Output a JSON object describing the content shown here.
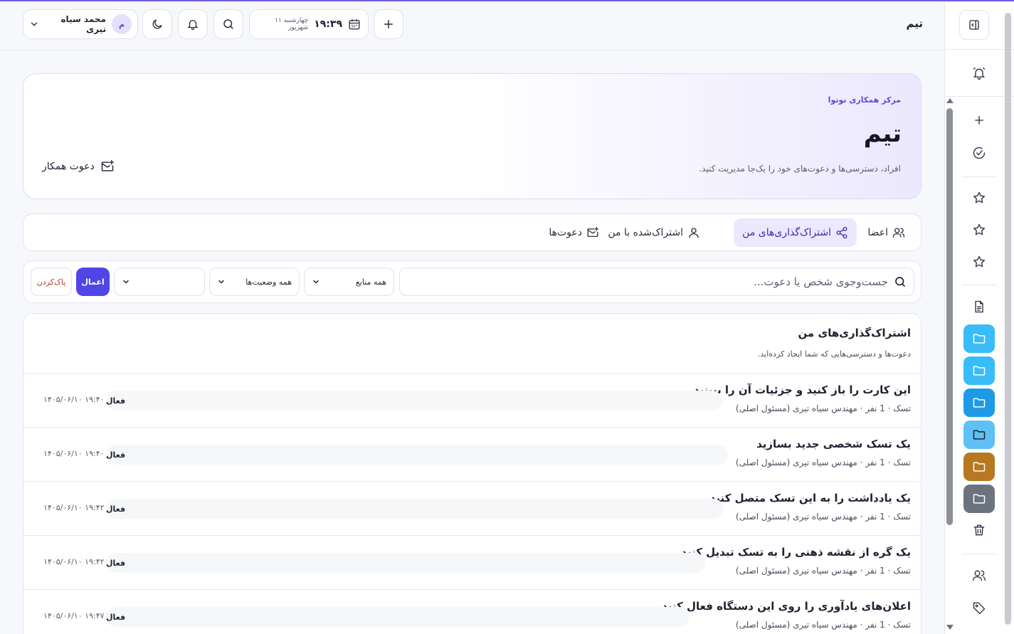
{
  "app": {
    "page_name": "تیم"
  },
  "header": {
    "time": "۱۹:۳۹",
    "date": "چهارشنبه ۱۱ شهریور",
    "user": {
      "initial": "م",
      "name": "محمد سیاه تیری"
    }
  },
  "hero": {
    "eyebrow": "مرکز همکاری نوتوا",
    "title": "تیم",
    "description": "افراد، دسترسی‌ها و دعوت‌های خود را یک‌جا مدیریت کنید.",
    "invite_label": "دعوت همکار"
  },
  "tabs": [
    {
      "label": "اعضا"
    },
    {
      "label": "اشتراک‌گذاری‌های من"
    },
    {
      "label": "اشتراک‌شده با من"
    },
    {
      "label": "دعوت‌ها"
    }
  ],
  "filters": {
    "search_placeholder": "جست‌وجوی شخص یا دعوت...",
    "source_select": "همه منابع",
    "status_select": "همه وضعیت‌ها",
    "third_select": "",
    "apply_label": "اعمال",
    "clear_label": "پاک‌کردن"
  },
  "list": {
    "title": "اشتراک‌گذاری‌های من",
    "subtitle": "دعوت‌ها و دسترسی‌هایی که شما ایجاد کرده‌اید.",
    "rows": [
      {
        "title": "این کارت را باز کنید و جزئیات آن را ببینید",
        "meta": "تسک · 1 نفر · مهندس سیاه تیری (مسئول اصلی)",
        "status": "فعال",
        "date": "۱۴۰۵/۰۶/۱۰ ۱۹:۴۰"
      },
      {
        "title": "یک تسک شخصی جدید بسازید",
        "meta": "تسک · 1 نفر · مهندس سیاه تیری (مسئول اصلی)",
        "status": "فعال",
        "date": "۱۴۰۵/۰۶/۱۰ ۱۹:۴۰"
      },
      {
        "title": "یک یادداشت را به این تسک متصل کنید",
        "meta": "تسک · 1 نفر · مهندس سیاه تیری (مسئول اصلی)",
        "status": "فعال",
        "date": "۱۴۰۵/۰۶/۱۰ ۱۹:۴۲"
      },
      {
        "title": "یک گره از نقشه ذهنی را به تسک تبدیل کنید",
        "meta": "تسک · 1 نفر · مهندس سیاه تیری (مسئول اصلی)",
        "status": "فعال",
        "date": "۱۴۰۵/۰۶/۱۰ ۱۹:۴۲"
      },
      {
        "title": "اعلان‌های یادآوری را روی این دستگاه فعال کنید",
        "meta": "تسک · 1 نفر · مهندس سیاه تیری (مسئول اصلی)",
        "status": "فعال",
        "date": "۱۴۰۵/۰۶/۱۰ ۱۹:۴۷"
      }
    ]
  },
  "rail": {
    "folder_colors": [
      "#38bdf8",
      "#38bdf8",
      "#1e9be6",
      "#5fc0f5",
      "#b7791f",
      "#6b7280"
    ]
  },
  "colors": {
    "accent": "#4f46e5",
    "accent_soft": "#ece8fd"
  }
}
